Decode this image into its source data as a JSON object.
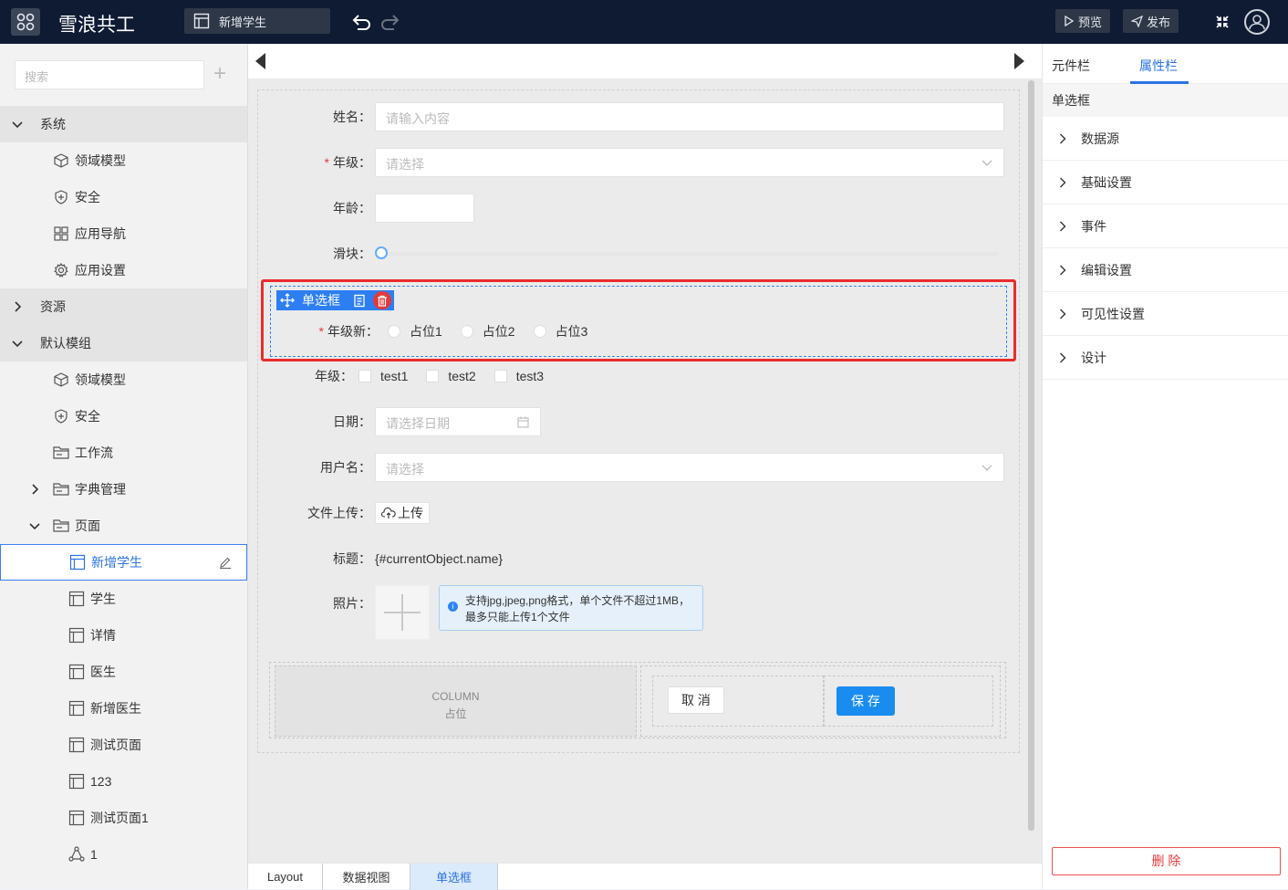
{
  "app": {
    "title": "雪浪共工"
  },
  "header": {
    "page_tab_label": "新增学生",
    "preview_label": "预览",
    "publish_label": "发布"
  },
  "sidebar": {
    "search_placeholder": "搜索",
    "items": [
      {
        "label": "系统",
        "type": "group",
        "expanded": true,
        "icon": "chevron-down-icon"
      },
      {
        "label": "领域模型",
        "type": "item",
        "icon": "cube-icon"
      },
      {
        "label": "安全",
        "type": "item",
        "icon": "shield-icon"
      },
      {
        "label": "应用导航",
        "type": "item",
        "icon": "grid-icon"
      },
      {
        "label": "应用设置",
        "type": "item",
        "icon": "gear-icon"
      },
      {
        "label": "资源",
        "type": "group",
        "expanded": false,
        "icon": "chevron-right-icon"
      },
      {
        "label": "默认模组",
        "type": "group",
        "expanded": true,
        "icon": "chevron-down-icon"
      },
      {
        "label": "领域模型",
        "type": "item",
        "icon": "cube-icon"
      },
      {
        "label": "安全",
        "type": "item",
        "icon": "shield-icon"
      },
      {
        "label": "工作流",
        "type": "item",
        "icon": "folder-icon"
      },
      {
        "label": "字典管理",
        "type": "folder",
        "icon": "folder-icon"
      },
      {
        "label": "页面",
        "type": "folder",
        "icon": "folder-icon"
      },
      {
        "label": "新增学生",
        "type": "page",
        "active": true,
        "icon": "page-icon"
      },
      {
        "label": "学生",
        "type": "page",
        "icon": "page-icon"
      },
      {
        "label": "详情",
        "type": "page",
        "icon": "page-icon"
      },
      {
        "label": "医生",
        "type": "page",
        "icon": "page-icon"
      },
      {
        "label": "新增医生",
        "type": "page",
        "icon": "page-icon"
      },
      {
        "label": "测试页面",
        "type": "page",
        "icon": "page-icon"
      },
      {
        "label": "123",
        "type": "page",
        "icon": "page-icon"
      },
      {
        "label": "测试页面1",
        "type": "page",
        "icon": "page-icon"
      },
      {
        "label": "1",
        "type": "page",
        "icon": "flow-icon"
      }
    ]
  },
  "form": {
    "name_label": "姓名",
    "name_placeholder": "请输入内容",
    "grade_label": "年级",
    "grade_placeholder": "请选择",
    "age_label": "年龄",
    "slider_label": "滑块",
    "selected_component_title": "单选框",
    "radio_label": "年级新",
    "radio_options": [
      "占位1",
      "占位2",
      "占位3"
    ],
    "checkbox_label": "年级",
    "checkbox_options": [
      "test1",
      "test2",
      "test3"
    ],
    "date_label": "日期",
    "date_placeholder": "请选择日期",
    "username_label": "用户名",
    "username_placeholder": "请选择",
    "upload_label": "文件上传",
    "upload_button": "上传",
    "title_label": "标题",
    "title_value": "{#currentObject.name}",
    "photo_label": "照片",
    "photo_tip": "支持jpg,jpeg,png格式，单个文件不超过1MB，最多只能上传1个文件",
    "column_title": "COLUMN",
    "column_sub": "占位",
    "cancel_label": "取 消",
    "save_label": "保 存"
  },
  "breadcrumbs": [
    "Layout",
    "数据视图",
    "单选框"
  ],
  "right_panel": {
    "tabs": [
      "元件栏",
      "属性栏"
    ],
    "active_tab": "属性栏",
    "component_name": "单选框",
    "sections": [
      "数据源",
      "基础设置",
      "事件",
      "编辑设置",
      "可见性设置",
      "设计"
    ],
    "delete_label": "删 除"
  },
  "colors": {
    "topbar": "#0f1b33",
    "accent": "#2b73e6",
    "selection_border": "#ea2b2b",
    "primary_button": "#1a8cf0"
  }
}
